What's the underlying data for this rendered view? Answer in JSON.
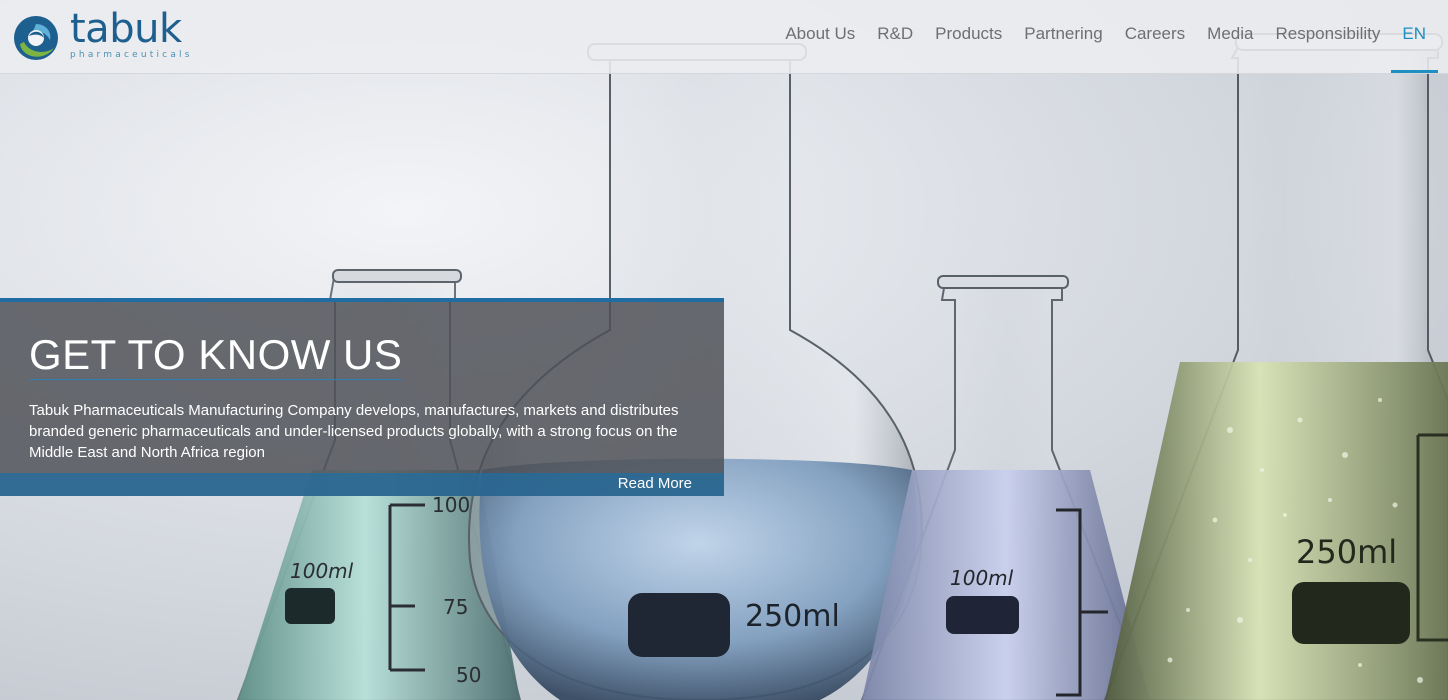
{
  "brand": {
    "name": "tabuk",
    "tagline": "pharmaceuticals",
    "logo_icon": "tabuk-swirl-logo",
    "colors": {
      "primary": "#1d5f8f",
      "accent": "#1d8fc0",
      "green": "#7cb342"
    }
  },
  "nav": {
    "items": [
      {
        "label": "About Us"
      },
      {
        "label": "R&D"
      },
      {
        "label": "Products"
      },
      {
        "label": "Partnering"
      },
      {
        "label": "Careers"
      },
      {
        "label": "Media"
      },
      {
        "label": "Responsibility"
      }
    ],
    "language": "EN"
  },
  "hero": {
    "title": "GET TO KNOW US",
    "description": "Tabuk Pharmaceuticals Manufacturing Company develops, manufactures, markets and distributes branded generic pharmaceuticals and under-licensed products globally, with a strong focus on the Middle East and North Africa region",
    "cta": "Read More",
    "flask_labels": {
      "left_volume": "100ml",
      "left_mark_top": "100",
      "left_mark_mid": "75",
      "left_mark_bottom": "50",
      "center_volume": "250ml",
      "right_small_volume": "100ml",
      "right_large_volume": "250ml"
    }
  }
}
